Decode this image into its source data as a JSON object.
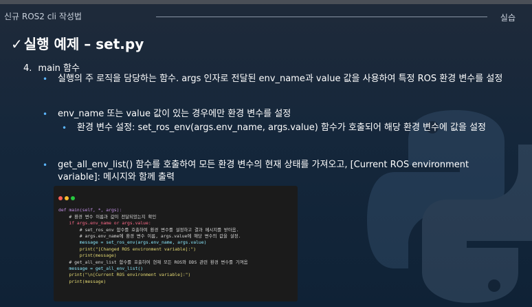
{
  "header": {
    "title": "신규 ROS2 cli 작성법",
    "tag": "실습"
  },
  "slide": {
    "check": "✓",
    "title": "실행 예제 – set.py"
  },
  "section": {
    "number": "4.",
    "label": "main 함수"
  },
  "bullets": [
    "실행의 주 로직을 담당하는 함수. args 인자로 전달된 env_name과 value 값을 사용하여 특정 ROS 환경 변수를 설정",
    "env_name 또는 value 값이 있는 경우에만 환경 변수를 설정",
    "환경 변수 설정: set_ros_env(args.env_name, args.value) 함수가 호출되어 해당 환경 변수에 값을 설정",
    "get_all_env_list() 함수를 호출하여 모든 환경 변수의 현재 상태를 가져오고, [Current ROS environment variable]: 메시지와 함께 출력"
  ],
  "code_lines": [
    "def main(self, *, args):",
    "    # 환경 변수 이름과 값이 전달되었는지 확인",
    "    if args.env_name or args.value:",
    "        # set_ros_env 함수를 호출하여 환경 변수를 설정하고 결과 메시지를 받아옴.",
    "        # args.env_name에 환경 변수 이름, args.value에 해당 변수의 값을 설정.",
    "        message = set_ros_env(args.env_name, args.value)",
    "        print(\"[Changed ROS environment variable]:\")",
    "        print(message)",
    "",
    "    # get_all_env_list 함수를 호출하여 현재 모든 ROS와 DDS 관련 환경 변수를 가져옴",
    "    message = get_all_env_list()",
    "    print(\"\\n[Current ROS environment variable]:\")",
    "    print(message)"
  ],
  "colors": {
    "accent": "#5bb6ff",
    "background": "#15273b",
    "code_bg": "#1b1b1b"
  },
  "icons": [
    "check-icon",
    "bullet-dot-icon",
    "python-logo-icon",
    "window-close-dot",
    "window-minimize-dot",
    "window-maximize-dot"
  ]
}
